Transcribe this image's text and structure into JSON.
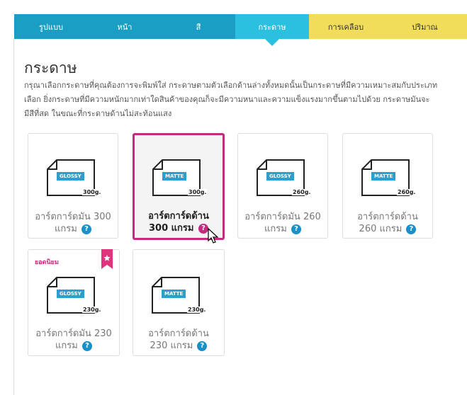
{
  "tabs": [
    {
      "label": "รูปแบบ",
      "style": "blue"
    },
    {
      "label": "หน้า",
      "style": "blue"
    },
    {
      "label": "สี",
      "style": "blue"
    },
    {
      "label": "กระดาษ",
      "style": "active"
    },
    {
      "label": "การเคลือบ",
      "style": "yellow"
    },
    {
      "label": "ปริมาณ",
      "style": "yellow"
    }
  ],
  "heading": "กระดาษ",
  "description": [
    "กรุณาเลือกกระดาษที่คุณต้องการจะพิมพ์ใส่ กระดาษตามตัวเลือกด้านล่างทั้งหมดนั้นเป็นกระดาษที่มีความเหมาะสมกับประเภท",
    "เลือก ยิ่งกระดาษที่มีความหนักมากเท่าใดสินค้าของคุณก็จะมีความหนาและความแข็งแรงมากขึ้นตามไปด้วย กระดาษมันจะ",
    "มีสีที่สด ในขณะที่กระดาษด้านไม่สะท้อนแสง"
  ],
  "papers": [
    {
      "tag": "GLOSSY",
      "weight": "300g.",
      "line1": "อาร์ตการ์ดมัน 300",
      "line2": "แกรม"
    },
    {
      "tag": "MATTE",
      "weight": "300g.",
      "line1": "อาร์ตการ์ดด้าน",
      "line2": "300 แกรม"
    },
    {
      "tag": "GLOSSY",
      "weight": "260g.",
      "line1": "อาร์ตการ์ดมัน 260",
      "line2": "แกรม"
    },
    {
      "tag": "MATTE",
      "weight": "260g.",
      "line1": "อาร์ตการ์ดด้าน",
      "line2": "260 แกรม"
    },
    {
      "tag": "GLOSSY",
      "weight": "230g.",
      "line1": "อาร์ตการ์ดมัน 230",
      "line2": "แกรม"
    },
    {
      "tag": "MATTE",
      "weight": "230g.",
      "line1": "อาร์ตการ์ดด้าน",
      "line2": "230 แกรม"
    }
  ],
  "popular_label": "ยอดนิยม",
  "help_glyph": "?",
  "colors": {
    "tab_blue": "#1a9ec4",
    "tab_active": "#2bbfe0",
    "tab_yellow": "#f2dd5a",
    "accent_pink": "#c42a7e",
    "help_blue": "#1a8fc8"
  }
}
